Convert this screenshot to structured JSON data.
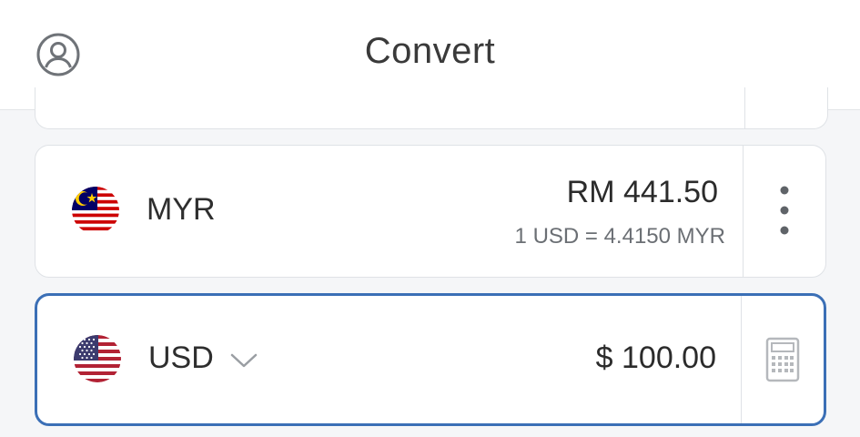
{
  "header": {
    "title": "Convert",
    "profile_icon": "user-profile-icon"
  },
  "cards": [
    {
      "code": "MYR",
      "amount": "RM 441.50",
      "rate": "1 USD = 4.4150 MYR",
      "flag_icon": "malaysia-flag-icon",
      "action_icon": "more-vertical-icon",
      "active": false
    },
    {
      "code": "USD",
      "amount": "$ 100.00",
      "flag_icon": "usa-flag-icon",
      "action_icon": "calculator-icon",
      "active": true
    }
  ],
  "colors": {
    "active_border": "#3b6fb6",
    "card_border": "#dfe2e6",
    "background": "#f5f6f8",
    "rate_text": "#6b6f74"
  }
}
